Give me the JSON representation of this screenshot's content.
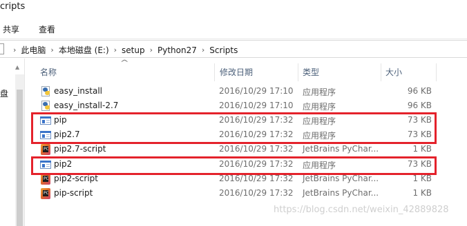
{
  "window": {
    "title_fragment": "cripts"
  },
  "ribbon": {
    "tabs": [
      "共享",
      "查看"
    ]
  },
  "address_bar": {
    "breadcrumbs": [
      "此电脑",
      "本地磁盘 (E:)",
      "setup",
      "Python27",
      "Scripts"
    ]
  },
  "left_pane": {
    "label_fragment": "盘"
  },
  "columns": {
    "name": "名称",
    "date": "修改日期",
    "type": "类型",
    "size": "大小"
  },
  "files": [
    {
      "name": "easy_install",
      "date": "2016/10/29 17:10",
      "type": "应用程序",
      "size": "96 KB",
      "icon": "python-exe-icon"
    },
    {
      "name": "easy_install-2.7",
      "date": "2016/10/29 17:10",
      "type": "应用程序",
      "size": "96 KB",
      "icon": "python-exe-icon"
    },
    {
      "name": "pip",
      "date": "2016/10/29 17:32",
      "type": "应用程序",
      "size": "73 KB",
      "icon": "exe-icon"
    },
    {
      "name": "pip2.7",
      "date": "2016/10/29 17:32",
      "type": "应用程序",
      "size": "73 KB",
      "icon": "exe-icon"
    },
    {
      "name": "pip2.7-script",
      "date": "2016/10/29 17:32",
      "type": "JetBrains PyChar...",
      "size": "1 KB",
      "icon": "pycharm-script-icon"
    },
    {
      "name": "pip2",
      "date": "2016/10/29 17:32",
      "type": "应用程序",
      "size": "73 KB",
      "icon": "exe-icon"
    },
    {
      "name": "pip2-script",
      "date": "2016/10/29 17:32",
      "type": "JetBrains PyChar...",
      "size": "1 KB",
      "icon": "pycharm-script-icon"
    },
    {
      "name": "pip-script",
      "date": "2016/10/29 17:32",
      "type": "JetBrains PyChar...",
      "size": "1 KB",
      "icon": "pycharm-script-icon"
    }
  ],
  "highlight_color": "#e4222b",
  "watermark": "https://blog.csdn.net/weixin_42889828"
}
